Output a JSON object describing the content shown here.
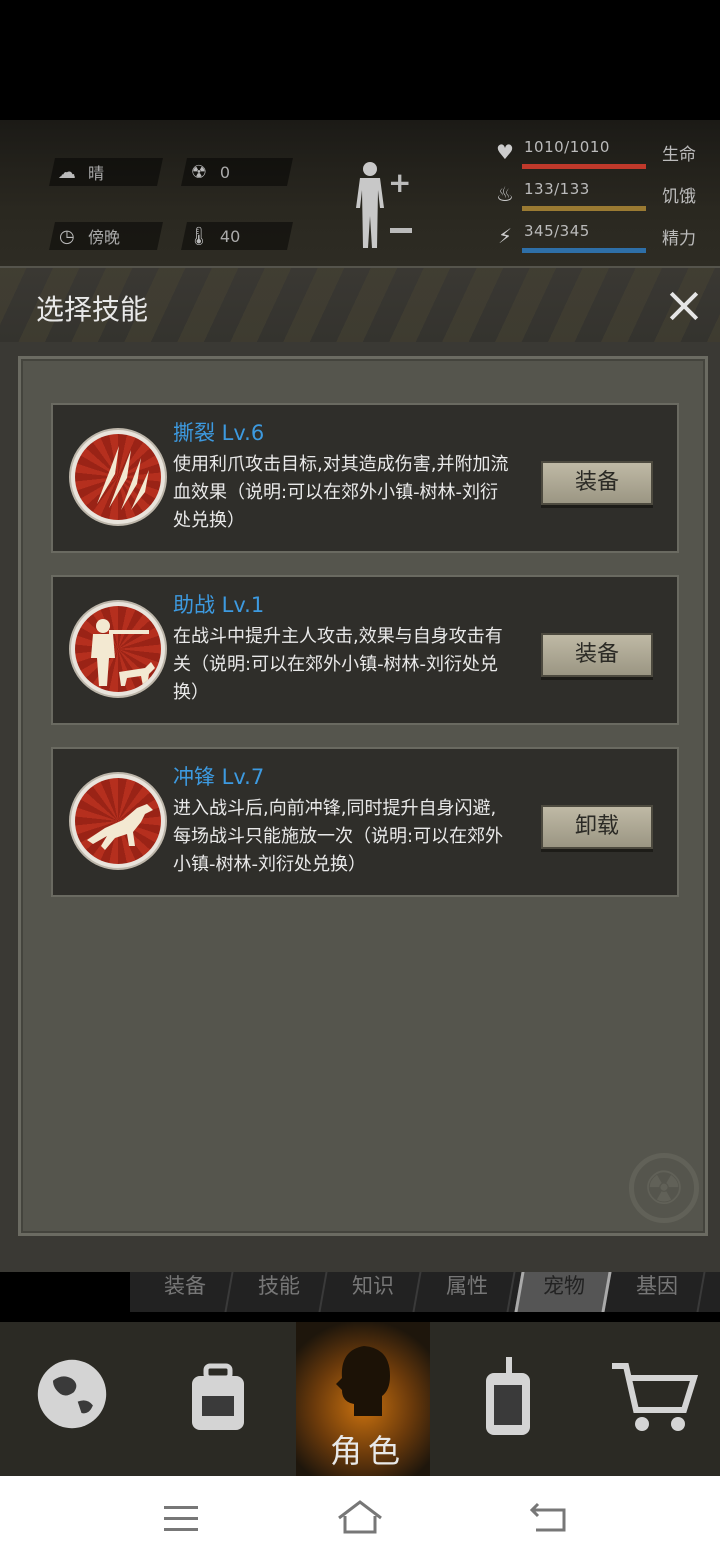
{
  "status": {
    "weather": {
      "icon": "cloud-sun-icon",
      "label": "晴"
    },
    "radiation": {
      "icon": "radiation-icon",
      "value": "0"
    },
    "time": {
      "icon": "clock-icon",
      "label": "傍晚"
    },
    "temperature": {
      "icon": "thermometer-icon",
      "value": "40"
    },
    "bars": [
      {
        "icon": "heart-icon",
        "value": "1010/1010",
        "label": "生命",
        "color": "#c0392b",
        "fraction": 1.0
      },
      {
        "icon": "stomach-icon",
        "value": "133/133",
        "label": "饥饿",
        "color": "#9a7a32",
        "fraction": 1.0
      },
      {
        "icon": "energy-icon",
        "value": "345/345",
        "label": "精力",
        "color": "#2e6fa8",
        "fraction": 1.0
      }
    ]
  },
  "modal": {
    "title": "选择技能",
    "skills": [
      {
        "icon": "claw-icon",
        "name": "撕裂 Lv.6",
        "description": "使用利爪攻击目标,对其造成伤害,并附加流血效果（说明:可以在郊外小镇-树林-刘衍处兑换）",
        "button": "装备"
      },
      {
        "icon": "hunter-dog-icon",
        "name": "助战 Lv.1",
        "description": "在战斗中提升主人攻击,效果与自身攻击有关（说明:可以在郊外小镇-树林-刘衍处兑换）",
        "button": "装备"
      },
      {
        "icon": "charging-dog-icon",
        "name": "冲锋 Lv.7",
        "description": "进入战斗后,向前冲锋,同时提升自身闪避,每场战斗只能施放一次（说明:可以在郊外小镇-树林-刘衍处兑换）",
        "button": "卸载"
      }
    ]
  },
  "sub_tabs": [
    "装备",
    "技能",
    "知识",
    "属性",
    "宠物",
    "基因"
  ],
  "sub_tab_active": "宠物",
  "bottom_nav": {
    "items": [
      {
        "icon": "globe-icon"
      },
      {
        "icon": "backpack-icon"
      },
      {
        "icon": "character-head-icon",
        "label": "角色"
      },
      {
        "icon": "walkie-talkie-icon"
      },
      {
        "icon": "cart-icon"
      }
    ],
    "active_index": 2
  },
  "system_nav": {
    "icons": [
      "menu-icon",
      "home-icon",
      "back-icon"
    ]
  }
}
